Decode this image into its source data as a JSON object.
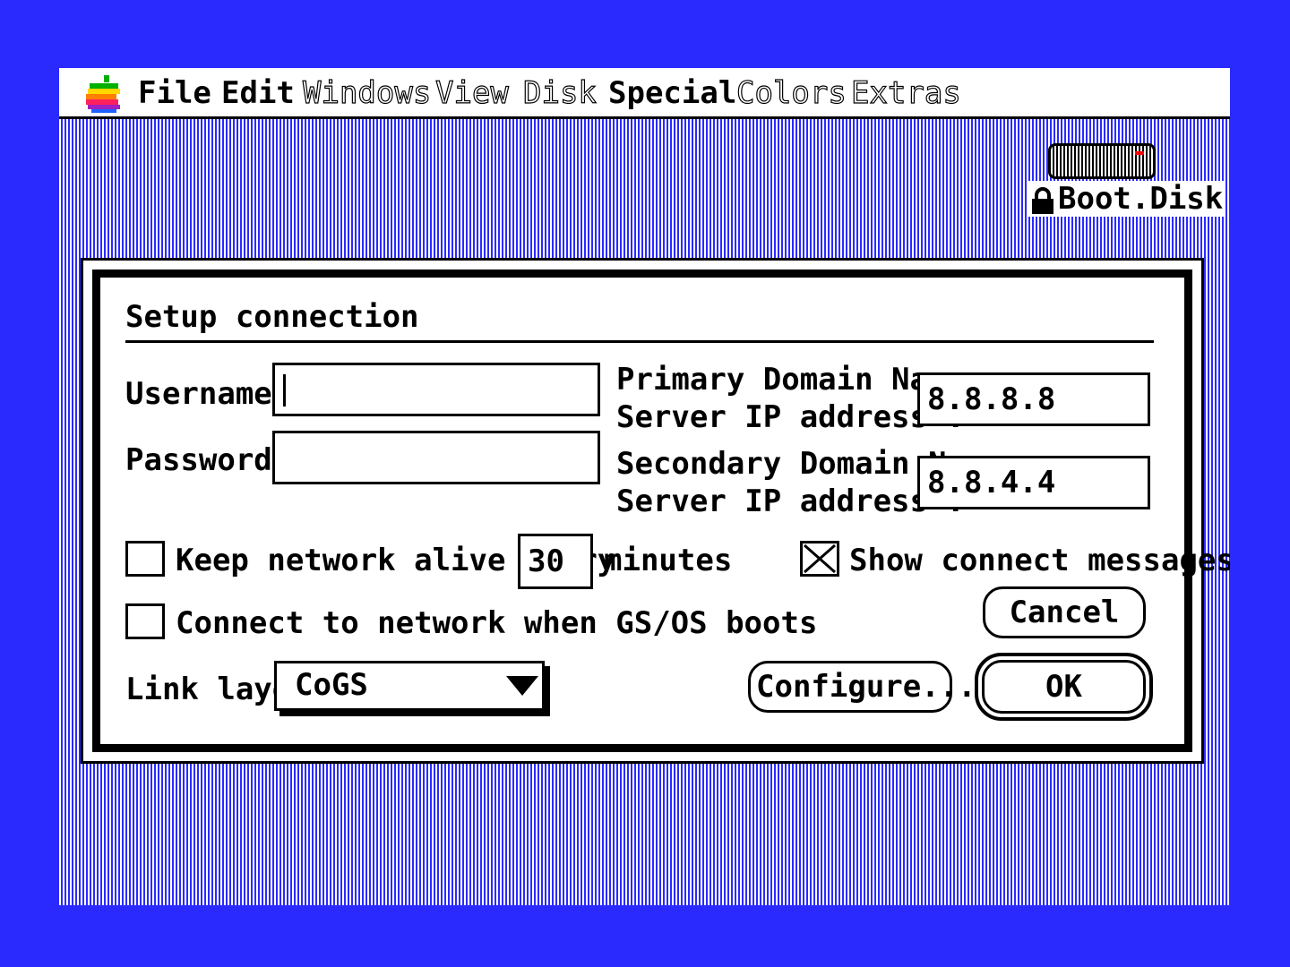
{
  "menubar": {
    "items": [
      {
        "label": "File",
        "enabled": true
      },
      {
        "label": "Edit",
        "enabled": true
      },
      {
        "label": "Windows",
        "enabled": false
      },
      {
        "label": "View",
        "enabled": false
      },
      {
        "label": "Disk",
        "enabled": false
      },
      {
        "label": "Special",
        "enabled": true
      },
      {
        "label": "Colors",
        "enabled": false
      },
      {
        "label": "Extras",
        "enabled": false
      }
    ]
  },
  "desktop": {
    "disk_label": "Boot.Disk"
  },
  "dialog": {
    "title": "Setup connection",
    "username_label": "Username:",
    "username_value": "",
    "password_label": "Password:",
    "password_value": "",
    "primary_dns_label_line1": "Primary Domain Name",
    "primary_dns_label_line2": "Server IP address :",
    "primary_dns_value": "8.8.8.8",
    "secondary_dns_label_line1": "Secondary Domain Name",
    "secondary_dns_label_line2": "Server IP address :",
    "secondary_dns_value": "8.8.4.4",
    "keep_alive_label": "Keep network alive every",
    "keep_alive_checked": false,
    "keep_alive_minutes": "30",
    "minutes_label": "minutes",
    "show_messages_label": "Show connect messages",
    "show_messages_checked": true,
    "connect_on_boot_label": "Connect to network when GS/OS boots",
    "connect_on_boot_checked": false,
    "link_layer_label": "Link layer:",
    "link_layer_value": "CoGS",
    "cancel_label": "Cancel",
    "configure_label": "Configure...",
    "ok_label": "OK"
  },
  "colors": {
    "desktop_blue": "#2a2aff",
    "disk_led": "#ff0000"
  }
}
